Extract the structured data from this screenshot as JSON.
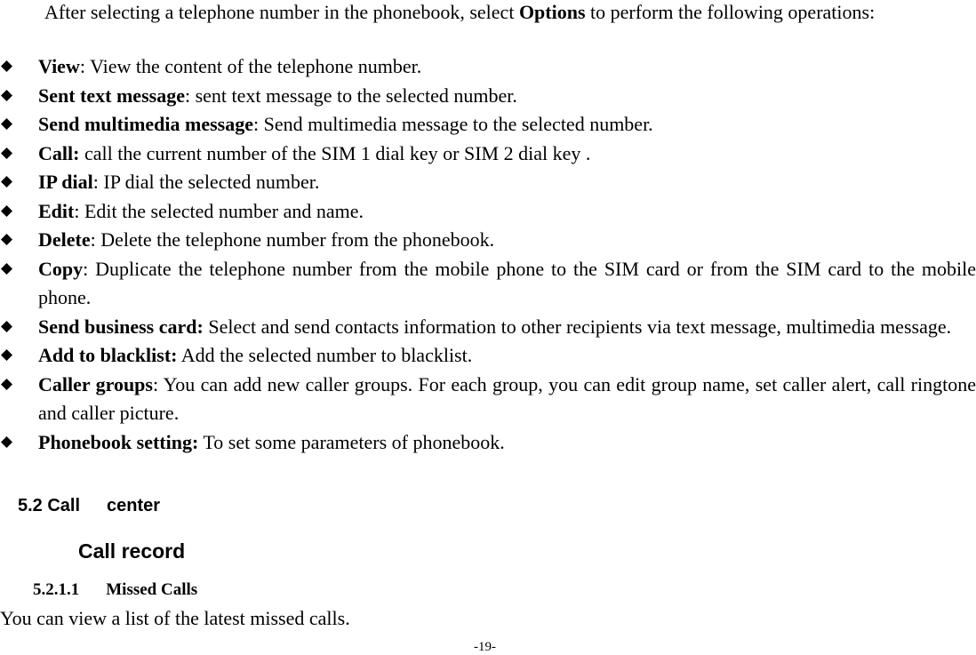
{
  "intro": {
    "before": "After selecting a telephone number in the phonebook, select ",
    "bold": "Options",
    "after": " to perform the following operations:"
  },
  "bullets": [
    {
      "term": "View",
      "sep": ":",
      "desc": " View the content of the telephone number."
    },
    {
      "term": "Sent text message",
      "sep": ":",
      "desc": " sent text message to the selected number."
    },
    {
      "term": "Send multimedia message",
      "sep": ":",
      "desc": " Send multimedia message to the selected number."
    },
    {
      "term": "Call:",
      "sep": "",
      "desc": " call the current number of the SIM 1 dial key or SIM 2 dial key ."
    },
    {
      "term": "IP dial",
      "sep": ":",
      "desc": " IP dial the selected number."
    },
    {
      "term": "Edit",
      "sep": ":",
      "desc": " Edit the selected number and name."
    },
    {
      "term": "Delete",
      "sep": ":",
      "desc": " Delete the telephone number from the phonebook."
    },
    {
      "term": "Copy",
      "sep": ":",
      "desc": " Duplicate the telephone number from the mobile phone to the SIM card or from the SIM card to the mobile phone."
    },
    {
      "term": "Send business card:",
      "sep": "",
      "desc": " Select and send contacts information to other recipients via text message, multimedia message."
    },
    {
      "term": "Add to blacklist:",
      "sep": "",
      "desc": " Add the selected number to blacklist."
    },
    {
      "term": "Caller groups",
      "sep": ":",
      "desc": " You can add new caller groups. For each group, you can edit group name, set caller alert, call ringtone and caller picture."
    },
    {
      "term": "Phonebook setting:",
      "sep": "",
      "desc": " To set some parameters of phonebook."
    }
  ],
  "bullet_icon": "diamond-bullet-icon",
  "section": {
    "number": "5.2 Call",
    "title": "center"
  },
  "subsection": {
    "title": "Call record"
  },
  "subsubsection": {
    "number": "5.2.1.1",
    "title": "Missed Calls"
  },
  "paragraph": "You can view a list of the latest missed calls.",
  "page_number": "-19-"
}
